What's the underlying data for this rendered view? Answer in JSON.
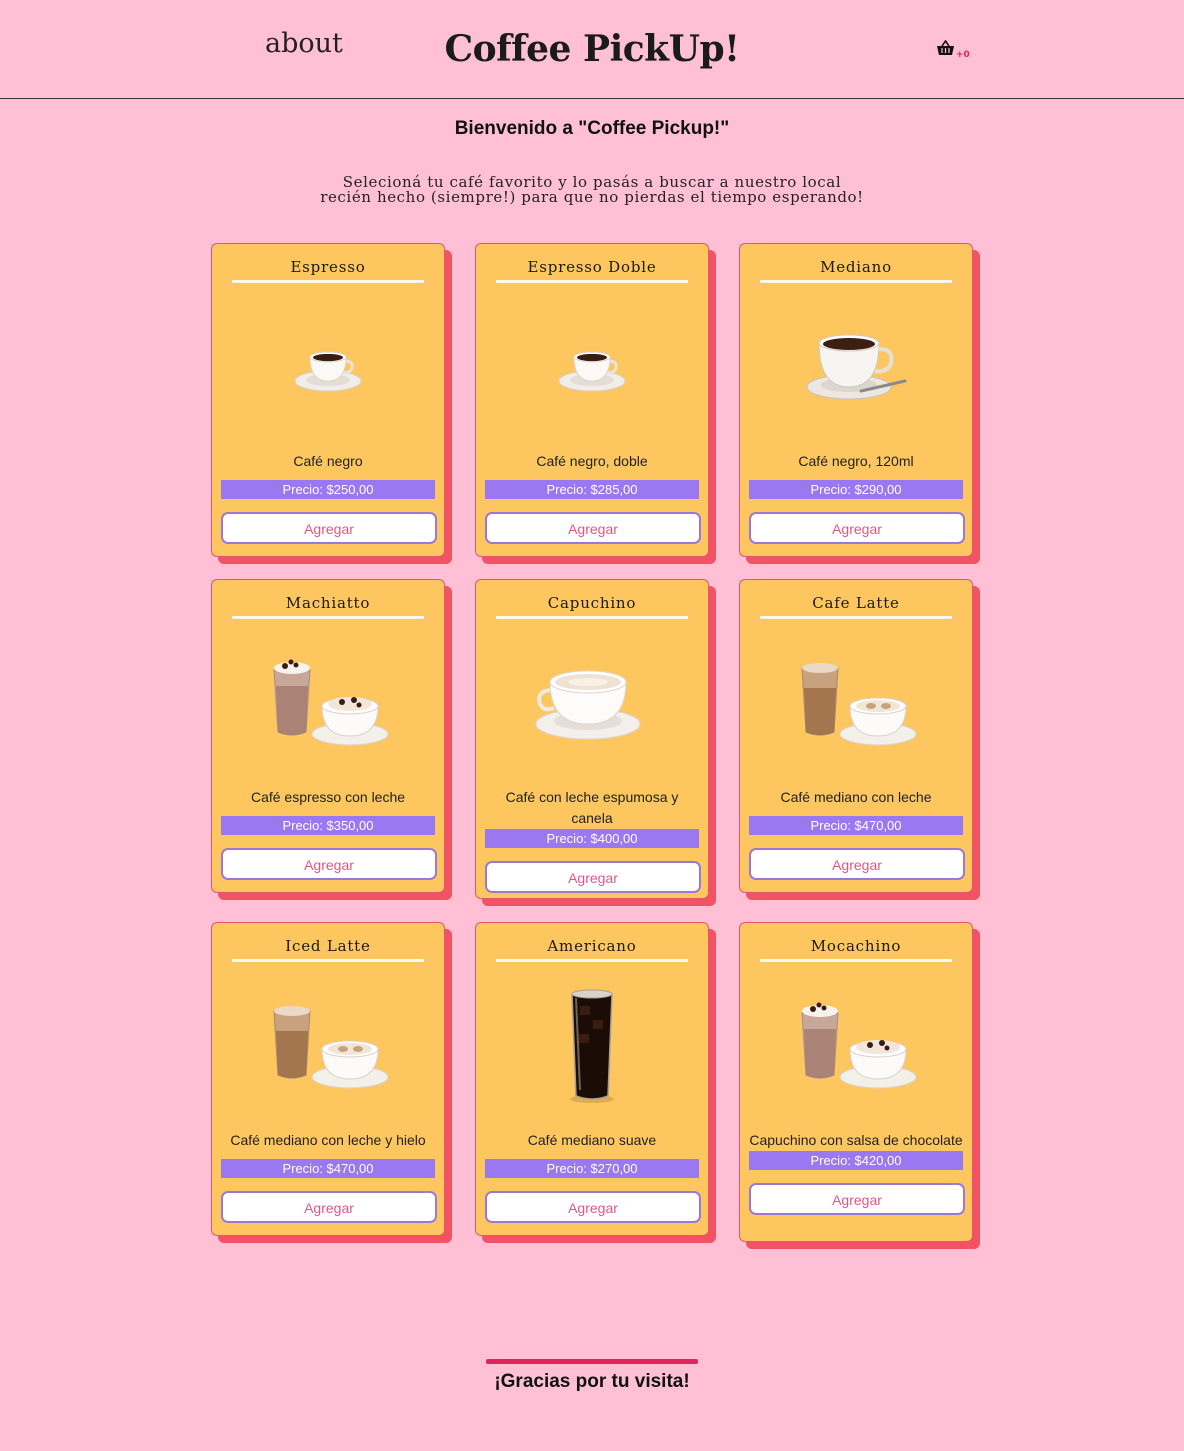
{
  "nav": {
    "about": "about",
    "brand": "Coffee PickUp!",
    "cart_count": "+0"
  },
  "hero": {
    "welcome": "Bienvenido a \"Coffee Pickup!\"",
    "intro_line1": "Selecioná tu café favorito y lo pasás a buscar a nuestro local",
    "intro_line2": "recién hecho (siempre!) para que no pierdas el tiempo esperando!"
  },
  "products": [
    {
      "title": "Espresso",
      "desc": "Café negro",
      "price": "Precio: $250,00",
      "button": "Agregar",
      "image": "espresso-cup"
    },
    {
      "title": "Espresso Doble",
      "desc": "Café negro, doble",
      "price": "Precio: $285,00",
      "button": "Agregar",
      "image": "espresso-cup"
    },
    {
      "title": "Mediano",
      "desc": "Café negro, 120ml",
      "price": "Precio: $290,00",
      "button": "Agregar",
      "image": "medium-cup"
    },
    {
      "title": "Machiatto",
      "desc": "Café espresso con leche",
      "price": "Precio: $350,00",
      "button": "Agregar",
      "image": "glass-and-cup-cream"
    },
    {
      "title": "Capuchino",
      "desc": "Café con leche espumosa y canela",
      "price": "Precio: $400,00",
      "button": "Agregar",
      "image": "cappuccino-cup"
    },
    {
      "title": "Cafe Latte",
      "desc": "Café mediano con leche",
      "price": "Precio: $470,00",
      "button": "Agregar",
      "image": "glass-and-cup-latte"
    },
    {
      "title": "Iced Latte",
      "desc": "Café mediano con leche y hielo",
      "price": "Precio: $470,00",
      "button": "Agregar",
      "image": "glass-and-cup-latte"
    },
    {
      "title": "Americano",
      "desc": "Café mediano suave",
      "price": "Precio: $270,00",
      "button": "Agregar",
      "image": "americano-glass"
    },
    {
      "title": "Mocachino",
      "desc": "Capuchino con salsa de chocolate",
      "price": "Precio: $420,00",
      "button": "Agregar",
      "image": "glass-and-cup-cream"
    }
  ],
  "footer": {
    "text": "¡Gracias por tu visita!"
  },
  "colors": {
    "background": "#ffc0d6",
    "card": "#fec65e",
    "card_shadow": "#f25264",
    "price_bar": "#9a78f2",
    "button_text": "#e0578a",
    "footer_bar": "#e0245e"
  }
}
